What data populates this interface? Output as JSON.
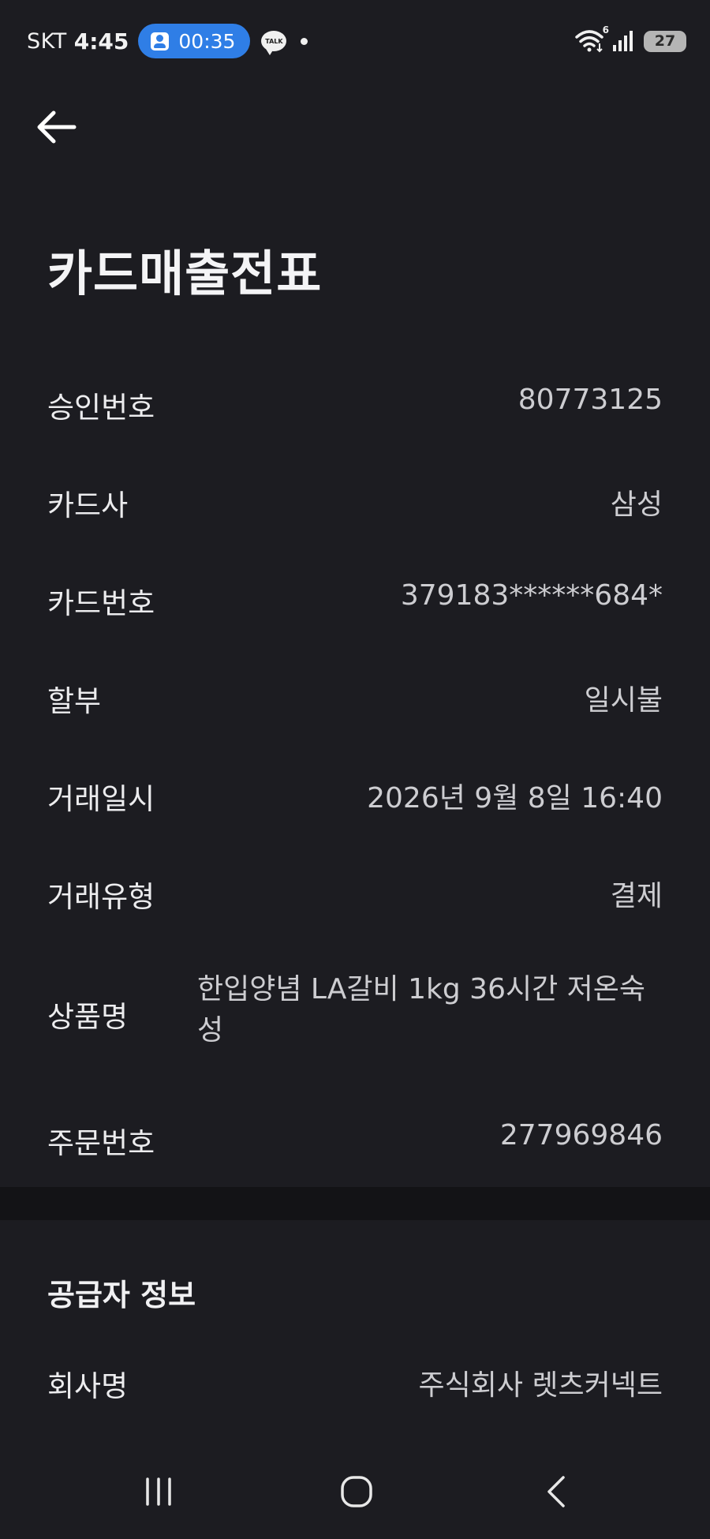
{
  "status_bar": {
    "carrier": "SKT",
    "time": "4:45",
    "call_timer": "00:35",
    "talk_badge": "TALK",
    "wifi_label": "6",
    "battery": "27"
  },
  "header": {
    "title": "카드매출전표"
  },
  "receipt": {
    "approval_number": {
      "label": "승인번호",
      "value": "80773125"
    },
    "card_company": {
      "label": "카드사",
      "value": "삼성"
    },
    "card_number": {
      "label": "카드번호",
      "value": "379183******684*"
    },
    "installment": {
      "label": "할부",
      "value": "일시불"
    },
    "transaction_datetime": {
      "label": "거래일시",
      "value": "2026년 9월 8일 16:40"
    },
    "transaction_type": {
      "label": "거래유형",
      "value": "결제"
    },
    "product_name": {
      "label": "상품명",
      "value": "한입양념 LA갈비 1kg 36시간 저온숙성"
    },
    "order_number": {
      "label": "주문번호",
      "value": "277969846"
    }
  },
  "supplier": {
    "section_title": "공급자 정보",
    "company_name": {
      "label": "회사명",
      "value": "주식회사 렛츠커넥트"
    }
  },
  "colors": {
    "background": "#1c1c21",
    "divider": "#131316",
    "call_pill": "#2f7ee6"
  },
  "icons": [
    "back-arrow-icon",
    "person-icon",
    "talk-icon",
    "wifi-icon",
    "signal-icon",
    "battery-icon",
    "recents-icon",
    "home-icon",
    "back-nav-icon"
  ]
}
